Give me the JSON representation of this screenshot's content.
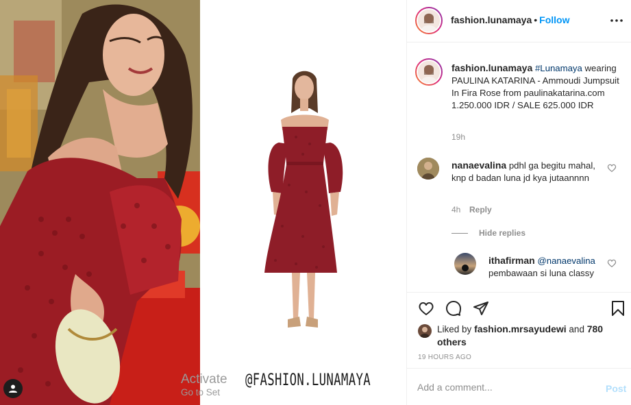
{
  "post": {
    "author": "fashion.lunamaya",
    "follow_label": "Follow",
    "separator": "•",
    "watermark": "@FASHION.LUNAMAYA"
  },
  "caption": {
    "username": "fashion.lunamaya",
    "hashtag": "#Lunamaya",
    "text": "wearing PAULINA KATARINA - Ammoudi Jumpsuit In Fira Rose from paulinakatarina.com 1.250.000 IDR / SALE 625.000 IDR",
    "time": "19h"
  },
  "comments": [
    {
      "username": "nanaevalina",
      "text": "pdhl ga begitu mahal, knp d badan luna jd kya jutaannnn",
      "time": "4h",
      "reply_label": "Reply",
      "hide_replies_label": "Hide replies",
      "replies": [
        {
          "username": "ithafirman",
          "mention": "@nanaevalina",
          "text": "pembawaan si luna classy"
        }
      ]
    }
  ],
  "likes": {
    "prefix": "Liked by",
    "username": "fashion.mrsayudewi",
    "suffix": "and",
    "others": "780 others"
  },
  "timestamp": "19 HOURS AGO",
  "add_comment": {
    "placeholder": "Add a comment...",
    "post_label": "Post"
  },
  "os_overlay": {
    "line1": "Activate",
    "line2": "Go to Set"
  },
  "colors": {
    "follow": "#0095f6",
    "hashtag": "#00376b",
    "meta": "#8e8e8e",
    "post_disabled": "#b2dffc",
    "dress": "#8e1d28"
  },
  "icons": [
    "more-icon",
    "heart-icon",
    "comment-icon",
    "share-icon",
    "bookmark-icon",
    "user-tag-icon"
  ]
}
